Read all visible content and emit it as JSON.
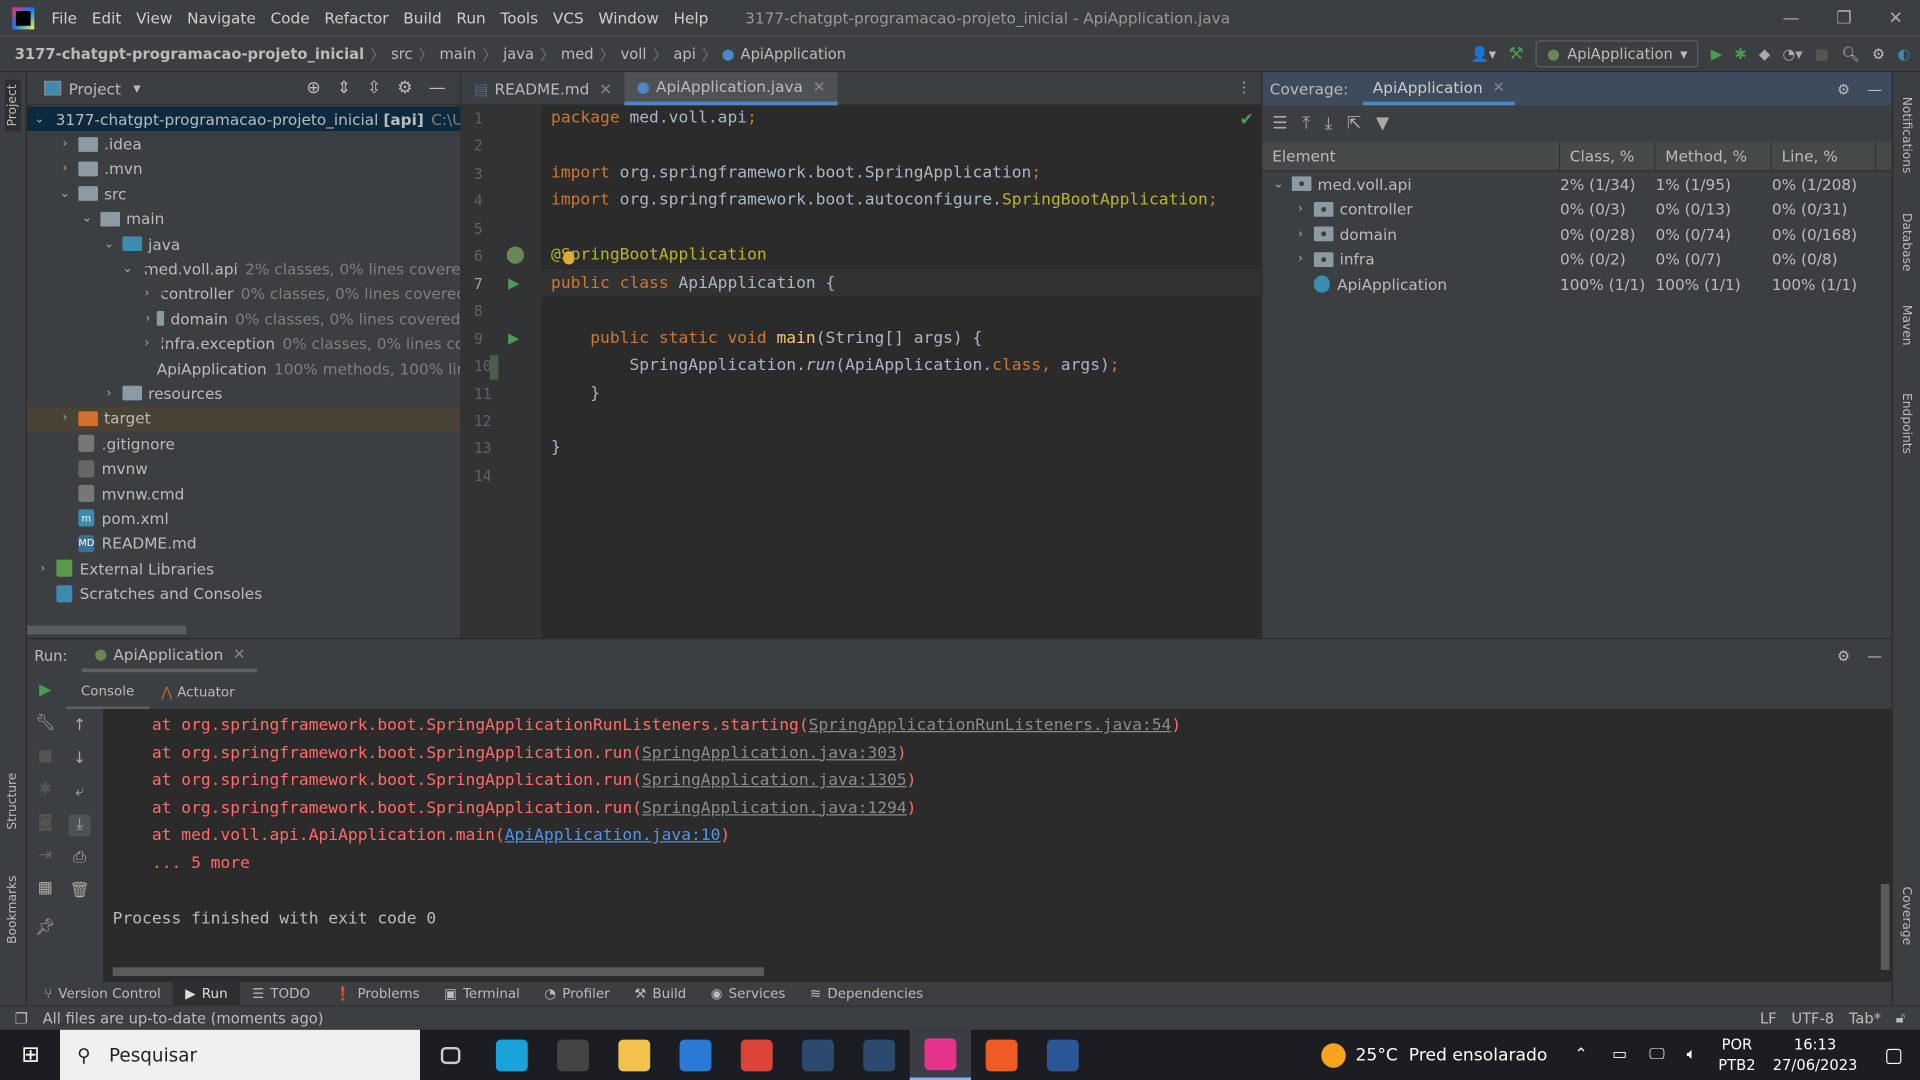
{
  "menu": {
    "items": [
      "File",
      "Edit",
      "View",
      "Navigate",
      "Code",
      "Refactor",
      "Build",
      "Run",
      "Tools",
      "VCS",
      "Window",
      "Help"
    ],
    "window_title": "3177-chatgpt-programacao-projeto_inicial - ApiApplication.java"
  },
  "breadcrumb": [
    "3177-chatgpt-programacao-projeto_inicial",
    "src",
    "main",
    "java",
    "med",
    "voll",
    "api",
    "ApiApplication"
  ],
  "run_config": "ApiApplication",
  "left_stripe": {
    "project": "Project",
    "structure": "Structure",
    "bookmarks": "Bookmarks"
  },
  "right_stripe": [
    "Notifications",
    "Database",
    "Maven",
    "Endpoints",
    "Coverage"
  ],
  "project": {
    "title": "Project",
    "tree": [
      {
        "label": "3177-chatgpt-programacao-projeto_inicial",
        "bold": "[api]",
        "hint": "C:\\Users",
        "depth": 0,
        "arrow": "open",
        "icon": "module"
      },
      {
        "label": ".idea",
        "depth": 1,
        "arrow": "closed",
        "icon": "folder"
      },
      {
        "label": ".mvn",
        "depth": 1,
        "arrow": "closed",
        "icon": "folder"
      },
      {
        "label": "src",
        "depth": 1,
        "arrow": "open",
        "icon": "folder"
      },
      {
        "label": "main",
        "depth": 2,
        "arrow": "open",
        "icon": "folder"
      },
      {
        "label": "java",
        "depth": 3,
        "arrow": "open",
        "icon": "source"
      },
      {
        "label": "med.voll.api",
        "hint": "2% classes, 0% lines covered",
        "depth": 4,
        "arrow": "open",
        "icon": "package"
      },
      {
        "label": "controller",
        "hint": "0% classes, 0% lines covered",
        "depth": 5,
        "arrow": "closed",
        "icon": "package"
      },
      {
        "label": "domain",
        "hint": "0% classes, 0% lines covered",
        "depth": 5,
        "arrow": "closed",
        "icon": "package"
      },
      {
        "label": "infra.exception",
        "hint": "0% classes, 0% lines cove",
        "depth": 5,
        "arrow": "closed",
        "icon": "package"
      },
      {
        "label": "ApiApplication",
        "hint": "100% methods, 100% lir",
        "depth": 5,
        "arrow": "none",
        "icon": "spring"
      },
      {
        "label": "resources",
        "depth": 3,
        "arrow": "closed",
        "icon": "resources"
      },
      {
        "label": "target",
        "depth": 1,
        "arrow": "closed",
        "icon": "excluded"
      },
      {
        "label": ".gitignore",
        "depth": 1,
        "arrow": "none",
        "icon": "file"
      },
      {
        "label": "mvnw",
        "depth": 1,
        "arrow": "none",
        "icon": "script"
      },
      {
        "label": "mvnw.cmd",
        "depth": 1,
        "arrow": "none",
        "icon": "file"
      },
      {
        "label": "pom.xml",
        "depth": 1,
        "arrow": "none",
        "icon": "maven"
      },
      {
        "label": "README.md",
        "depth": 1,
        "arrow": "none",
        "icon": "md"
      },
      {
        "label": "External Libraries",
        "depth": 0,
        "arrow": "closed",
        "icon": "libs"
      },
      {
        "label": "Scratches and Consoles",
        "depth": 0,
        "arrow": "none",
        "icon": "scratch"
      }
    ]
  },
  "editor": {
    "tabs": [
      {
        "label": "README.md",
        "active": false
      },
      {
        "label": "ApiApplication.java",
        "active": true
      }
    ],
    "current_line": 7,
    "lines": [
      [
        [
          "package ",
          "kw"
        ],
        [
          "med.voll.api",
          ""
        ],
        [
          ";",
          "kw"
        ]
      ],
      [],
      [
        [
          "import ",
          "kw"
        ],
        [
          "org.springframework.boot.SpringApplication",
          ""
        ],
        [
          ";",
          "kw"
        ]
      ],
      [
        [
          "import ",
          "kw"
        ],
        [
          "org.springframework.boot.autoconfigure.",
          ""
        ],
        [
          "SpringBootApplication",
          "an"
        ],
        [
          ";",
          "kw"
        ]
      ],
      [],
      [
        [
          "@SpringBootApplication",
          "an"
        ]
      ],
      [
        [
          "public class ",
          "kw"
        ],
        [
          "ApiApplication {",
          ""
        ]
      ],
      [],
      [
        [
          "    public static void ",
          "kw"
        ],
        [
          "main",
          "fn"
        ],
        [
          "(String[] args) {",
          ""
        ]
      ],
      [
        [
          "        SpringApplication.",
          ""
        ],
        [
          "run",
          "it"
        ],
        [
          "(ApiApplication.",
          ""
        ],
        [
          "class",
          "kw"
        ],
        [
          ", ",
          "kw"
        ],
        [
          "args)",
          ""
        ],
        [
          ";",
          "kw"
        ]
      ],
      [
        [
          "    }",
          ""
        ]
      ],
      [],
      [
        [
          "}",
          ""
        ]
      ],
      []
    ]
  },
  "coverage": {
    "label": "Coverage:",
    "tab": "ApiApplication",
    "columns": [
      "Element",
      "Class, %",
      "Method, %",
      "Line, %"
    ],
    "rows": [
      {
        "name": "med.voll.api",
        "cls": "2% (1/34)",
        "method": "1% (1/95)",
        "line": "0% (1/208)",
        "depth": 0,
        "arrow": "open",
        "icon": "package"
      },
      {
        "name": "controller",
        "cls": "0% (0/3)",
        "method": "0% (0/13)",
        "line": "0% (0/31)",
        "depth": 1,
        "arrow": "closed",
        "icon": "package"
      },
      {
        "name": "domain",
        "cls": "0% (0/28)",
        "method": "0% (0/74)",
        "line": "0% (0/168)",
        "depth": 1,
        "arrow": "closed",
        "icon": "package"
      },
      {
        "name": "infra",
        "cls": "0% (0/2)",
        "method": "0% (0/7)",
        "line": "0% (0/8)",
        "depth": 1,
        "arrow": "closed",
        "icon": "package"
      },
      {
        "name": "ApiApplication",
        "cls": "100% (1/1)",
        "method": "100% (1/1)",
        "line": "100% (1/1)",
        "depth": 1,
        "arrow": "none",
        "icon": "spring"
      }
    ]
  },
  "run": {
    "label": "Run:",
    "tab": "ApiApplication",
    "subtabs": [
      "Console",
      "Actuator"
    ],
    "console": [
      {
        "text": "    at org.springframework.boot.SpringApplicationRunListeners.starting(",
        "link": "SpringApplicationRunListeners.java:54",
        "end": ")"
      },
      {
        "text": "    at org.springframework.boot.SpringApplication.run(",
        "link": "SpringApplication.java:303",
        "end": ")"
      },
      {
        "text": "    at org.springframework.boot.SpringApplication.run(",
        "link": "SpringApplication.java:1305",
        "end": ")"
      },
      {
        "text": "    at org.springframework.boot.SpringApplication.run(",
        "link": "SpringApplication.java:1294",
        "end": ")"
      },
      {
        "text": "    at med.voll.api.ApiApplication.main(",
        "link": "ApiApplication.java:10",
        "end": ")",
        "blue": true
      },
      {
        "text": "    ... 5 more",
        "link": "",
        "end": ""
      },
      {
        "text": "",
        "link": "",
        "end": ""
      },
      {
        "text": "Process finished with exit code 0",
        "link": "",
        "end": "",
        "normal": true
      }
    ]
  },
  "toolwindows": [
    "Version Control",
    "Run",
    "TODO",
    "Problems",
    "Terminal",
    "Profiler",
    "Build",
    "Services",
    "Dependencies"
  ],
  "active_toolwindow": "Run",
  "status": {
    "message": "All files are up-to-date (moments ago)",
    "lf": "LF",
    "encoding": "UTF-8",
    "indent": "Tab*"
  },
  "taskbar": {
    "search": "Pesquisar",
    "weather": "25°C  Pred ensolarado",
    "lang1": "POR",
    "lang2": "PTB2",
    "time": "16:13",
    "date": "27/06/2023"
  },
  "colors": {
    "accent": "#4a88c7",
    "run_green": "#499c54",
    "error_red": "#ff6b68",
    "link_blue": "#5394ec"
  }
}
